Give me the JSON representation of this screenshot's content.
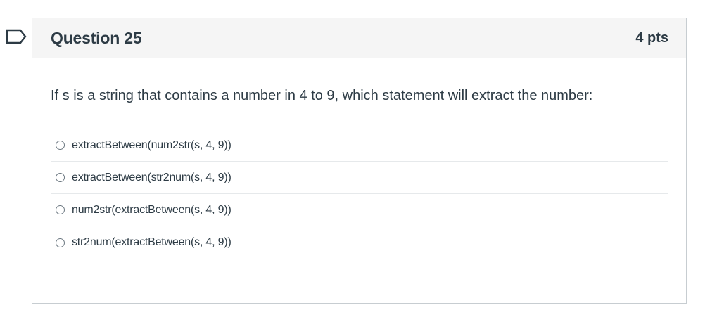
{
  "question": {
    "title": "Question 25",
    "points": "4 pts",
    "text": "If s is a string that contains a number in 4 to 9, which statement will extract the number:",
    "answers": [
      {
        "label": "extractBetween(num2str(s, 4, 9))",
        "selected": false
      },
      {
        "label": "extractBetween(str2num(s, 4, 9))",
        "selected": false
      },
      {
        "label": "num2str(extractBetween(s, 4, 9))",
        "selected": false
      },
      {
        "label": "str2num(extractBetween(s, 4, 9))",
        "selected": false
      }
    ]
  },
  "colors": {
    "flag": "#2d3b45",
    "header_bg": "#f5f5f5",
    "border": "#c7cdd1",
    "text": "#2d3b45"
  },
  "icons": {
    "flag": "flag-question-icon"
  }
}
